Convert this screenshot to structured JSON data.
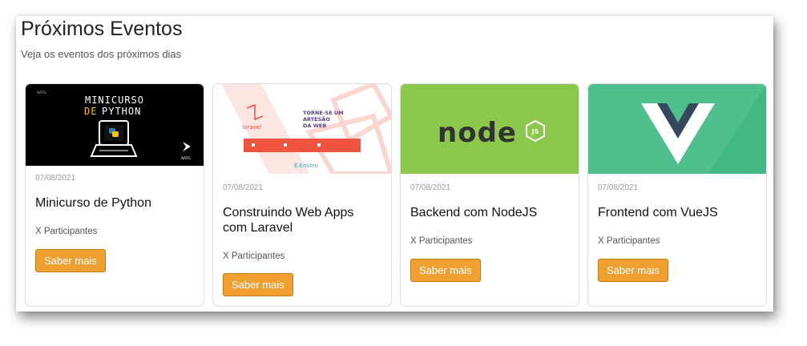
{
  "header": {
    "title": "Próximos Eventos",
    "subtitle": "Veja os eventos dos próximos dias"
  },
  "events": [
    {
      "date": "07/08/2021",
      "title": "Minicurso de Python",
      "participants": "X Participantes",
      "button": "Saber mais",
      "image": {
        "line1": "MINICURSO",
        "line2_prefix": "DE",
        "line2_word": "PYTHON",
        "brand": "NATIS"
      }
    },
    {
      "date": "07/08/2021",
      "title": "Construindo Web Apps com Laravel",
      "participants": "X Participantes",
      "button": "Saber mais",
      "image": {
        "heading": "TORNE-SE UM ARTESÃO DA WEB",
        "logo": "laravel",
        "footer": "E.Ensino"
      }
    },
    {
      "date": "07/08/2021",
      "title": "Backend com NodeJS",
      "participants": "X Participantes",
      "button": "Saber mais",
      "image": {
        "logo": "node",
        "badge": "JS"
      }
    },
    {
      "date": "07/08/2021",
      "title": "Frontend com VueJS",
      "participants": "X Participantes",
      "button": "Saber mais",
      "image": {
        "logo": "vue"
      }
    }
  ],
  "colors": {
    "button": "#f0a030",
    "python_bg": "#000000",
    "python_accent": "#f5c400",
    "laravel_red": "#f05340",
    "node_green": "#8cc84b",
    "vue_green": "#41b883",
    "vue_dark": "#35495e"
  }
}
